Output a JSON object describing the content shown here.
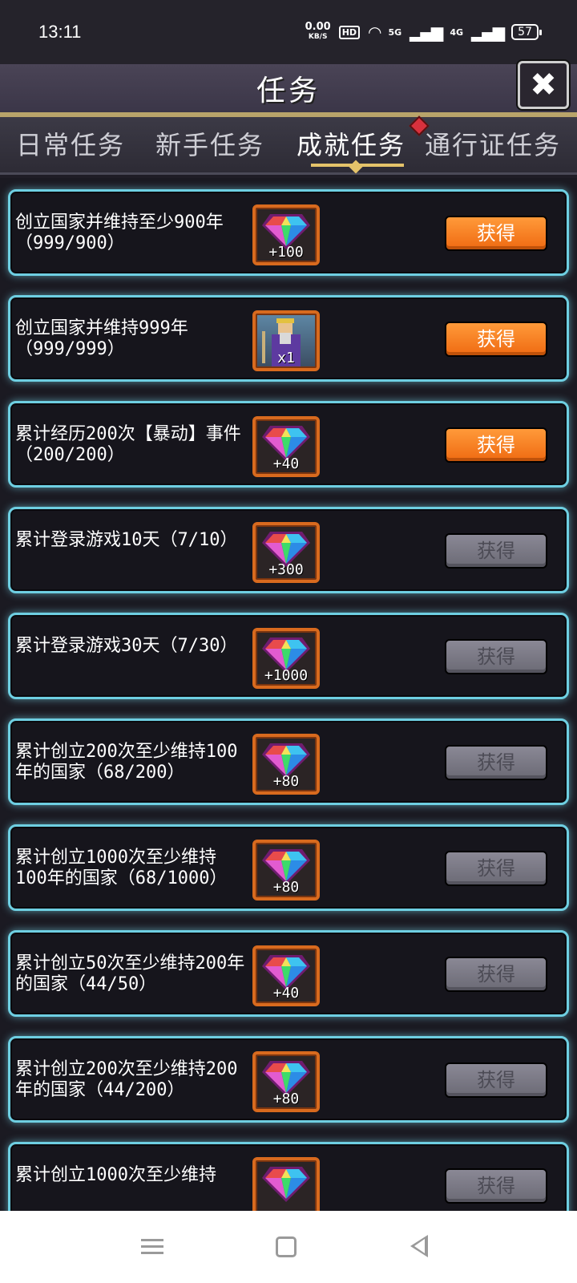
{
  "status_bar": {
    "time": "13:11",
    "net_speed": "0.00",
    "net_unit": "KB/S",
    "hd_label": "HD",
    "signal_1": "5G",
    "signal_2": "4G",
    "battery": "57"
  },
  "header": {
    "title": "任务",
    "close_icon": "close-icon"
  },
  "tabs": [
    {
      "label": "日常任务",
      "active": false
    },
    {
      "label": "新手任务",
      "active": false
    },
    {
      "label": "成就任务",
      "active": true
    },
    {
      "label": "通行证任务",
      "active": false
    }
  ],
  "tasks": [
    {
      "text": "创立国家并维持至少900年（999/900）",
      "reward": "+100",
      "icon": "gem-icon",
      "button": "获得",
      "enabled": true
    },
    {
      "text": "创立国家并维持999年（999/999）",
      "reward": "x1",
      "icon": "character-portrait-icon",
      "button": "获得",
      "enabled": true
    },
    {
      "text": "累计经历200次【暴动】事件（200/200）",
      "reward": "+40",
      "icon": "gem-icon",
      "button": "获得",
      "enabled": true
    },
    {
      "text": "累计登录游戏10天（7/10）",
      "reward": "+300",
      "icon": "gem-icon",
      "button": "获得",
      "enabled": false
    },
    {
      "text": "累计登录游戏30天（7/30）",
      "reward": "+1000",
      "icon": "gem-icon",
      "button": "获得",
      "enabled": false
    },
    {
      "text": "累计创立200次至少维持100年的国家（68/200）",
      "reward": "+80",
      "icon": "gem-icon",
      "button": "获得",
      "enabled": false
    },
    {
      "text": "累计创立1000次至少维持100年的国家（68/1000）",
      "reward": "+80",
      "icon": "gem-icon",
      "button": "获得",
      "enabled": false
    },
    {
      "text": "累计创立50次至少维持200年的国家（44/50）",
      "reward": "+40",
      "icon": "gem-icon",
      "button": "获得",
      "enabled": false
    },
    {
      "text": "累计创立200次至少维持200年的国家（44/200）",
      "reward": "+80",
      "icon": "gem-icon",
      "button": "获得",
      "enabled": false
    },
    {
      "text": "累计创立1000次至少维持",
      "reward": "",
      "icon": "gem-icon",
      "button": "获得",
      "enabled": false
    }
  ]
}
